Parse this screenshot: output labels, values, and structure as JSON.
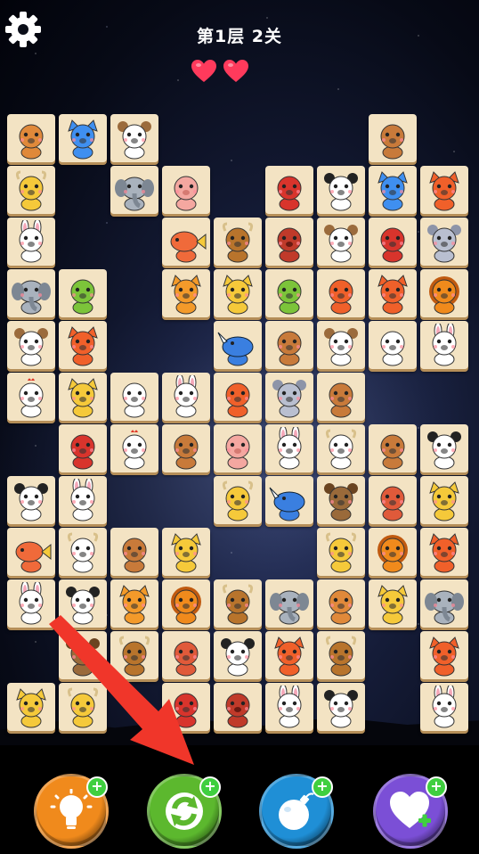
{
  "header": {
    "level_title": "第1层 2关",
    "lives": 2
  },
  "board": {
    "tiles": [
      {
        "col": 0,
        "row": 0,
        "animal": "raccoon"
      },
      {
        "col": 1,
        "row": 0,
        "animal": "cat"
      },
      {
        "col": 2,
        "row": 0,
        "animal": "monkey"
      },
      {
        "col": 7,
        "row": 0,
        "animal": "horse"
      },
      {
        "col": 0,
        "row": 1,
        "animal": "giraffe"
      },
      {
        "col": 2,
        "row": 1,
        "animal": "elephant"
      },
      {
        "col": 3,
        "row": 1,
        "animal": "pig"
      },
      {
        "col": 5,
        "row": 1,
        "animal": "gorilla"
      },
      {
        "col": 6,
        "row": 1,
        "animal": "panda"
      },
      {
        "col": 7,
        "row": 1,
        "animal": "cat"
      },
      {
        "col": 8,
        "row": 1,
        "animal": "fox"
      },
      {
        "col": 0,
        "row": 2,
        "animal": "rabbit"
      },
      {
        "col": 3,
        "row": 2,
        "animal": "fish"
      },
      {
        "col": 4,
        "row": 2,
        "animal": "ox"
      },
      {
        "col": 5,
        "row": 2,
        "animal": "boar"
      },
      {
        "col": 6,
        "row": 2,
        "animal": "monkey"
      },
      {
        "col": 7,
        "row": 2,
        "animal": "gorilla"
      },
      {
        "col": 8,
        "row": 2,
        "animal": "mouse"
      },
      {
        "col": 0,
        "row": 3,
        "animal": "elephant"
      },
      {
        "col": 1,
        "row": 3,
        "animal": "parrot"
      },
      {
        "col": 3,
        "row": 3,
        "animal": "tiger"
      },
      {
        "col": 4,
        "row": 3,
        "animal": "leopard"
      },
      {
        "col": 5,
        "row": 3,
        "animal": "parrot"
      },
      {
        "col": 6,
        "row": 3,
        "animal": "squirrel"
      },
      {
        "col": 7,
        "row": 3,
        "animal": "fox"
      },
      {
        "col": 8,
        "row": 3,
        "animal": "lion"
      },
      {
        "col": 0,
        "row": 4,
        "animal": "monkey"
      },
      {
        "col": 1,
        "row": 4,
        "animal": "fox"
      },
      {
        "col": 4,
        "row": 4,
        "animal": "rhino"
      },
      {
        "col": 5,
        "row": 4,
        "animal": "horse"
      },
      {
        "col": 6,
        "row": 4,
        "animal": "monkey"
      },
      {
        "col": 7,
        "row": 4,
        "animal": "sheep"
      },
      {
        "col": 8,
        "row": 4,
        "animal": "rabbit"
      },
      {
        "col": 0,
        "row": 5,
        "animal": "chicken"
      },
      {
        "col": 1,
        "row": 5,
        "animal": "leopard"
      },
      {
        "col": 2,
        "row": 5,
        "animal": "sheep"
      },
      {
        "col": 3,
        "row": 5,
        "animal": "rabbit"
      },
      {
        "col": 4,
        "row": 5,
        "animal": "squirrel"
      },
      {
        "col": 5,
        "row": 5,
        "animal": "mouse"
      },
      {
        "col": 6,
        "row": 5,
        "animal": "horse"
      },
      {
        "col": 1,
        "row": 6,
        "animal": "gorilla"
      },
      {
        "col": 2,
        "row": 6,
        "animal": "chicken"
      },
      {
        "col": 3,
        "row": 6,
        "animal": "horse"
      },
      {
        "col": 4,
        "row": 6,
        "animal": "pig"
      },
      {
        "col": 5,
        "row": 6,
        "animal": "rabbit"
      },
      {
        "col": 6,
        "row": 6,
        "animal": "cow"
      },
      {
        "col": 7,
        "row": 6,
        "animal": "horse"
      },
      {
        "col": 8,
        "row": 6,
        "animal": "panda"
      },
      {
        "col": 0,
        "row": 7,
        "animal": "panda"
      },
      {
        "col": 1,
        "row": 7,
        "animal": "rabbit"
      },
      {
        "col": 4,
        "row": 7,
        "animal": "giraffe"
      },
      {
        "col": 5,
        "row": 7,
        "animal": "rhino"
      },
      {
        "col": 6,
        "row": 7,
        "animal": "bear"
      },
      {
        "col": 7,
        "row": 7,
        "animal": "hedgehog"
      },
      {
        "col": 8,
        "row": 7,
        "animal": "leopard"
      },
      {
        "col": 0,
        "row": 8,
        "animal": "fish"
      },
      {
        "col": 1,
        "row": 8,
        "animal": "cow"
      },
      {
        "col": 2,
        "row": 8,
        "animal": "horse"
      },
      {
        "col": 3,
        "row": 8,
        "animal": "leopard"
      },
      {
        "col": 6,
        "row": 8,
        "animal": "giraffe"
      },
      {
        "col": 7,
        "row": 8,
        "animal": "lion"
      },
      {
        "col": 8,
        "row": 8,
        "animal": "fox"
      },
      {
        "col": 0,
        "row": 9,
        "animal": "rabbit"
      },
      {
        "col": 1,
        "row": 9,
        "animal": "panda"
      },
      {
        "col": 2,
        "row": 9,
        "animal": "tiger"
      },
      {
        "col": 3,
        "row": 9,
        "animal": "lion"
      },
      {
        "col": 4,
        "row": 9,
        "animal": "ox"
      },
      {
        "col": 5,
        "row": 9,
        "animal": "elephant"
      },
      {
        "col": 6,
        "row": 9,
        "animal": "raccoon"
      },
      {
        "col": 7,
        "row": 9,
        "animal": "leopard"
      },
      {
        "col": 8,
        "row": 9,
        "animal": "elephant"
      },
      {
        "col": 1,
        "row": 10,
        "animal": "bear"
      },
      {
        "col": 2,
        "row": 10,
        "animal": "ox"
      },
      {
        "col": 3,
        "row": 10,
        "animal": "hedgehog"
      },
      {
        "col": 4,
        "row": 10,
        "animal": "panda"
      },
      {
        "col": 5,
        "row": 10,
        "animal": "fox"
      },
      {
        "col": 6,
        "row": 10,
        "animal": "ox"
      },
      {
        "col": 8,
        "row": 10,
        "animal": "fox"
      },
      {
        "col": 0,
        "row": 11,
        "animal": "leopard"
      },
      {
        "col": 1,
        "row": 11,
        "animal": "giraffe"
      },
      {
        "col": 3,
        "row": 11,
        "animal": "gorilla"
      },
      {
        "col": 4,
        "row": 11,
        "animal": "boar"
      },
      {
        "col": 5,
        "row": 11,
        "animal": "rabbit"
      },
      {
        "col": 6,
        "row": 11,
        "animal": "panda"
      },
      {
        "col": 8,
        "row": 11,
        "animal": "rabbit"
      }
    ]
  },
  "toolbar": [
    {
      "name": "hint-button",
      "icon": "lightbulb-icon",
      "color": "#f08a1c"
    },
    {
      "name": "shuffle-button",
      "icon": "refresh-icon",
      "color": "#5cb82e"
    },
    {
      "name": "bomb-button",
      "icon": "bomb-icon",
      "color": "#1f8fd6"
    },
    {
      "name": "add-life-button",
      "icon": "heart-plus-icon",
      "color": "#7b4fd6"
    }
  ],
  "colors": {
    "tile": "#f3e3c3",
    "heart": "#ff3a5c",
    "arrow": "#f0362a",
    "plus_badge": "#3fcf3f"
  }
}
